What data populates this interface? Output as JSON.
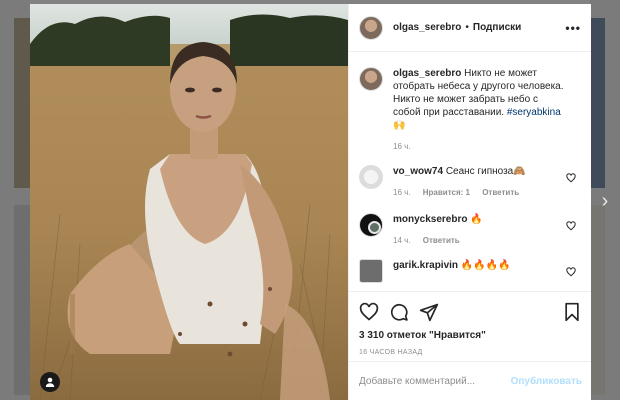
{
  "post": {
    "author": "olgas_serebro",
    "separator": "•",
    "follow_label": "Подписки",
    "more_label": "•••",
    "caption_user": "olgas_serebro",
    "caption_text": "Никто не может отобрать небеса у другого человека. Никто не может забрать небо с собой при расставании.",
    "caption_hashtag": "#seryabkina",
    "caption_emoji": "🙌",
    "caption_time": "16 ч."
  },
  "comments": [
    {
      "user": "vo_wow74",
      "text": "Сеанс гипноза🙈",
      "time": "16 ч.",
      "likes": "Нравится: 1",
      "reply": "Ответить"
    },
    {
      "user": "monyckserebro",
      "text": "🔥",
      "time": "14 ч.",
      "reply": "Ответить"
    },
    {
      "user": "garik.krapivin",
      "text": "🔥🔥🔥🔥"
    }
  ],
  "actions": {
    "likes_text": "3 310 отметок \"Нравится\"",
    "age_text": "16 часов назад"
  },
  "composer": {
    "placeholder": "Добавьте комментарий...",
    "post_label": "Опубликовать"
  },
  "nav": {
    "next_arrow": "›"
  },
  "colors": {
    "link": "#00376b",
    "post_button_disabled": "#b2dffc",
    "muted": "#8e8e8e",
    "text": "#262626"
  },
  "icons": [
    "heart-icon",
    "comment-icon",
    "share-icon",
    "bookmark-icon",
    "more-icon",
    "user-tag-icon",
    "chevron-right-icon"
  ]
}
